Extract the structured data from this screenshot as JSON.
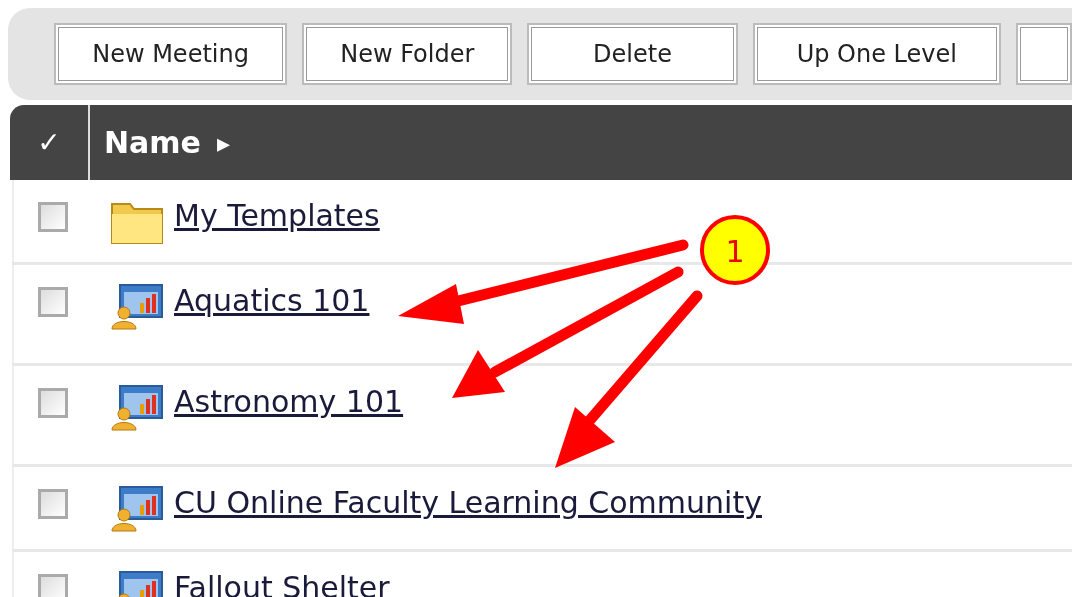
{
  "toolbar": {
    "buttons": [
      "New Meeting",
      "New Folder",
      "Delete",
      "Up One Level"
    ]
  },
  "table": {
    "header_check": "✓",
    "column": "Name",
    "sort_arrow": "▸",
    "rows": [
      {
        "kind": "folder",
        "name": "My Templates",
        "checked": false
      },
      {
        "kind": "meeting",
        "name": "Aquatics 101",
        "checked": false
      },
      {
        "kind": "meeting",
        "name": "Astronomy 101",
        "checked": false
      },
      {
        "kind": "meeting",
        "name": "CU Online Faculty Learning Community",
        "checked": false
      },
      {
        "kind": "meeting",
        "name": "Fallout Shelter",
        "checked": false
      }
    ]
  },
  "callout": {
    "label": "1"
  }
}
